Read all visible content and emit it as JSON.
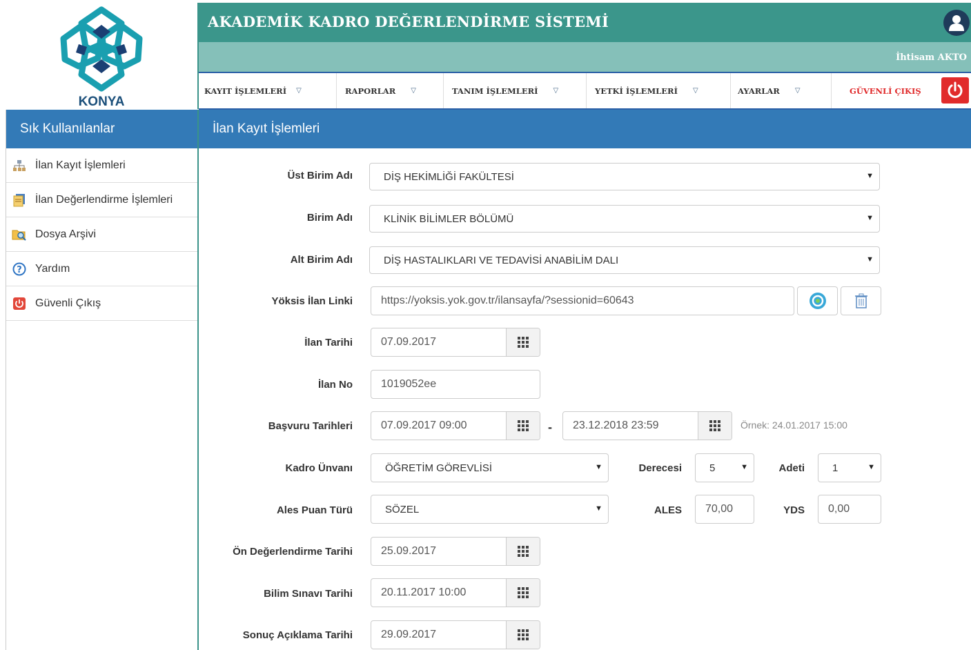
{
  "header": {
    "app_title": "AKADEMİK KADRO DEĞERLENDİRME SİSTEMİ",
    "user_name": "İhtisam AKTO",
    "logo_text": "KONYA"
  },
  "nav": {
    "items": [
      "KAYIT İŞLEMLERİ",
      "RAPORLAR",
      "TANIM İŞLEMLERİ",
      "YETKİ İŞLEMLERİ",
      "AYARLAR"
    ],
    "logout": "GÜVENLİ ÇIKIŞ"
  },
  "sidebar": {
    "title": "Sık Kullanılanlar",
    "items": [
      {
        "label": "İlan Kayıt İşlemleri",
        "icon": "sitemap-icon"
      },
      {
        "label": "İlan Değerlendirme İşlemleri",
        "icon": "edit-doc-icon"
      },
      {
        "label": "Dosya Arşivi",
        "icon": "folder-search-icon"
      },
      {
        "label": "Yardım",
        "icon": "help-icon"
      },
      {
        "label": "Güvenli Çıkış",
        "icon": "power-icon"
      }
    ]
  },
  "main": {
    "title": "İlan Kayıt İşlemleri"
  },
  "form": {
    "ust_birim": {
      "label": "Üst Birim Adı",
      "value": "DİŞ HEKİMLİĞİ FAKÜLTESİ"
    },
    "birim": {
      "label": "Birim Adı",
      "value": "KLİNİK BİLİMLER BÖLÜMÜ"
    },
    "alt_birim": {
      "label": "Alt Birim Adı",
      "value": "DİŞ HASTALIKLARI VE TEDAVİSİ ANABİLİM DALI"
    },
    "yoksis": {
      "label": "Yöksis İlan Linki",
      "value": "https://yoksis.yok.gov.tr/ilansayfa/?sessionid=60643"
    },
    "ilan_tarihi": {
      "label": "İlan Tarihi",
      "value": "07.09.2017"
    },
    "ilan_no": {
      "label": "İlan No",
      "value": "1019052ee"
    },
    "basvuru": {
      "label": "Başvuru Tarihleri",
      "start": "07.09.2017 09:00",
      "separator": "-",
      "end": "23.12.2018 23:59",
      "hint": "Örnek: 24.01.2017 15:00"
    },
    "kadro": {
      "label": "Kadro Ünvanı",
      "value": "ÖĞRETİM GÖREVLİSİ"
    },
    "derece": {
      "label": "Derecesi",
      "value": "5"
    },
    "adet": {
      "label": "Adeti",
      "value": "1"
    },
    "ales_tur": {
      "label": "Ales Puan Türü",
      "value": "SÖZEL"
    },
    "ales": {
      "label": "ALES",
      "value": "70,00"
    },
    "yds": {
      "label": "YDS",
      "value": "0,00"
    },
    "on_deg": {
      "label": "Ön Değerlendirme Tarihi",
      "value": "25.09.2017"
    },
    "bilim": {
      "label": "Bilim Sınavı Tarihi",
      "value": "20.11.2017 10:00"
    },
    "sonuc": {
      "label": "Sonuç Açıklama Tarihi",
      "value": "29.09.2017"
    }
  },
  "colors": {
    "header": "#3b968b",
    "subheader": "#85c0b9",
    "panel_blue": "#337ab7",
    "logout_red": "#e12b2b"
  }
}
